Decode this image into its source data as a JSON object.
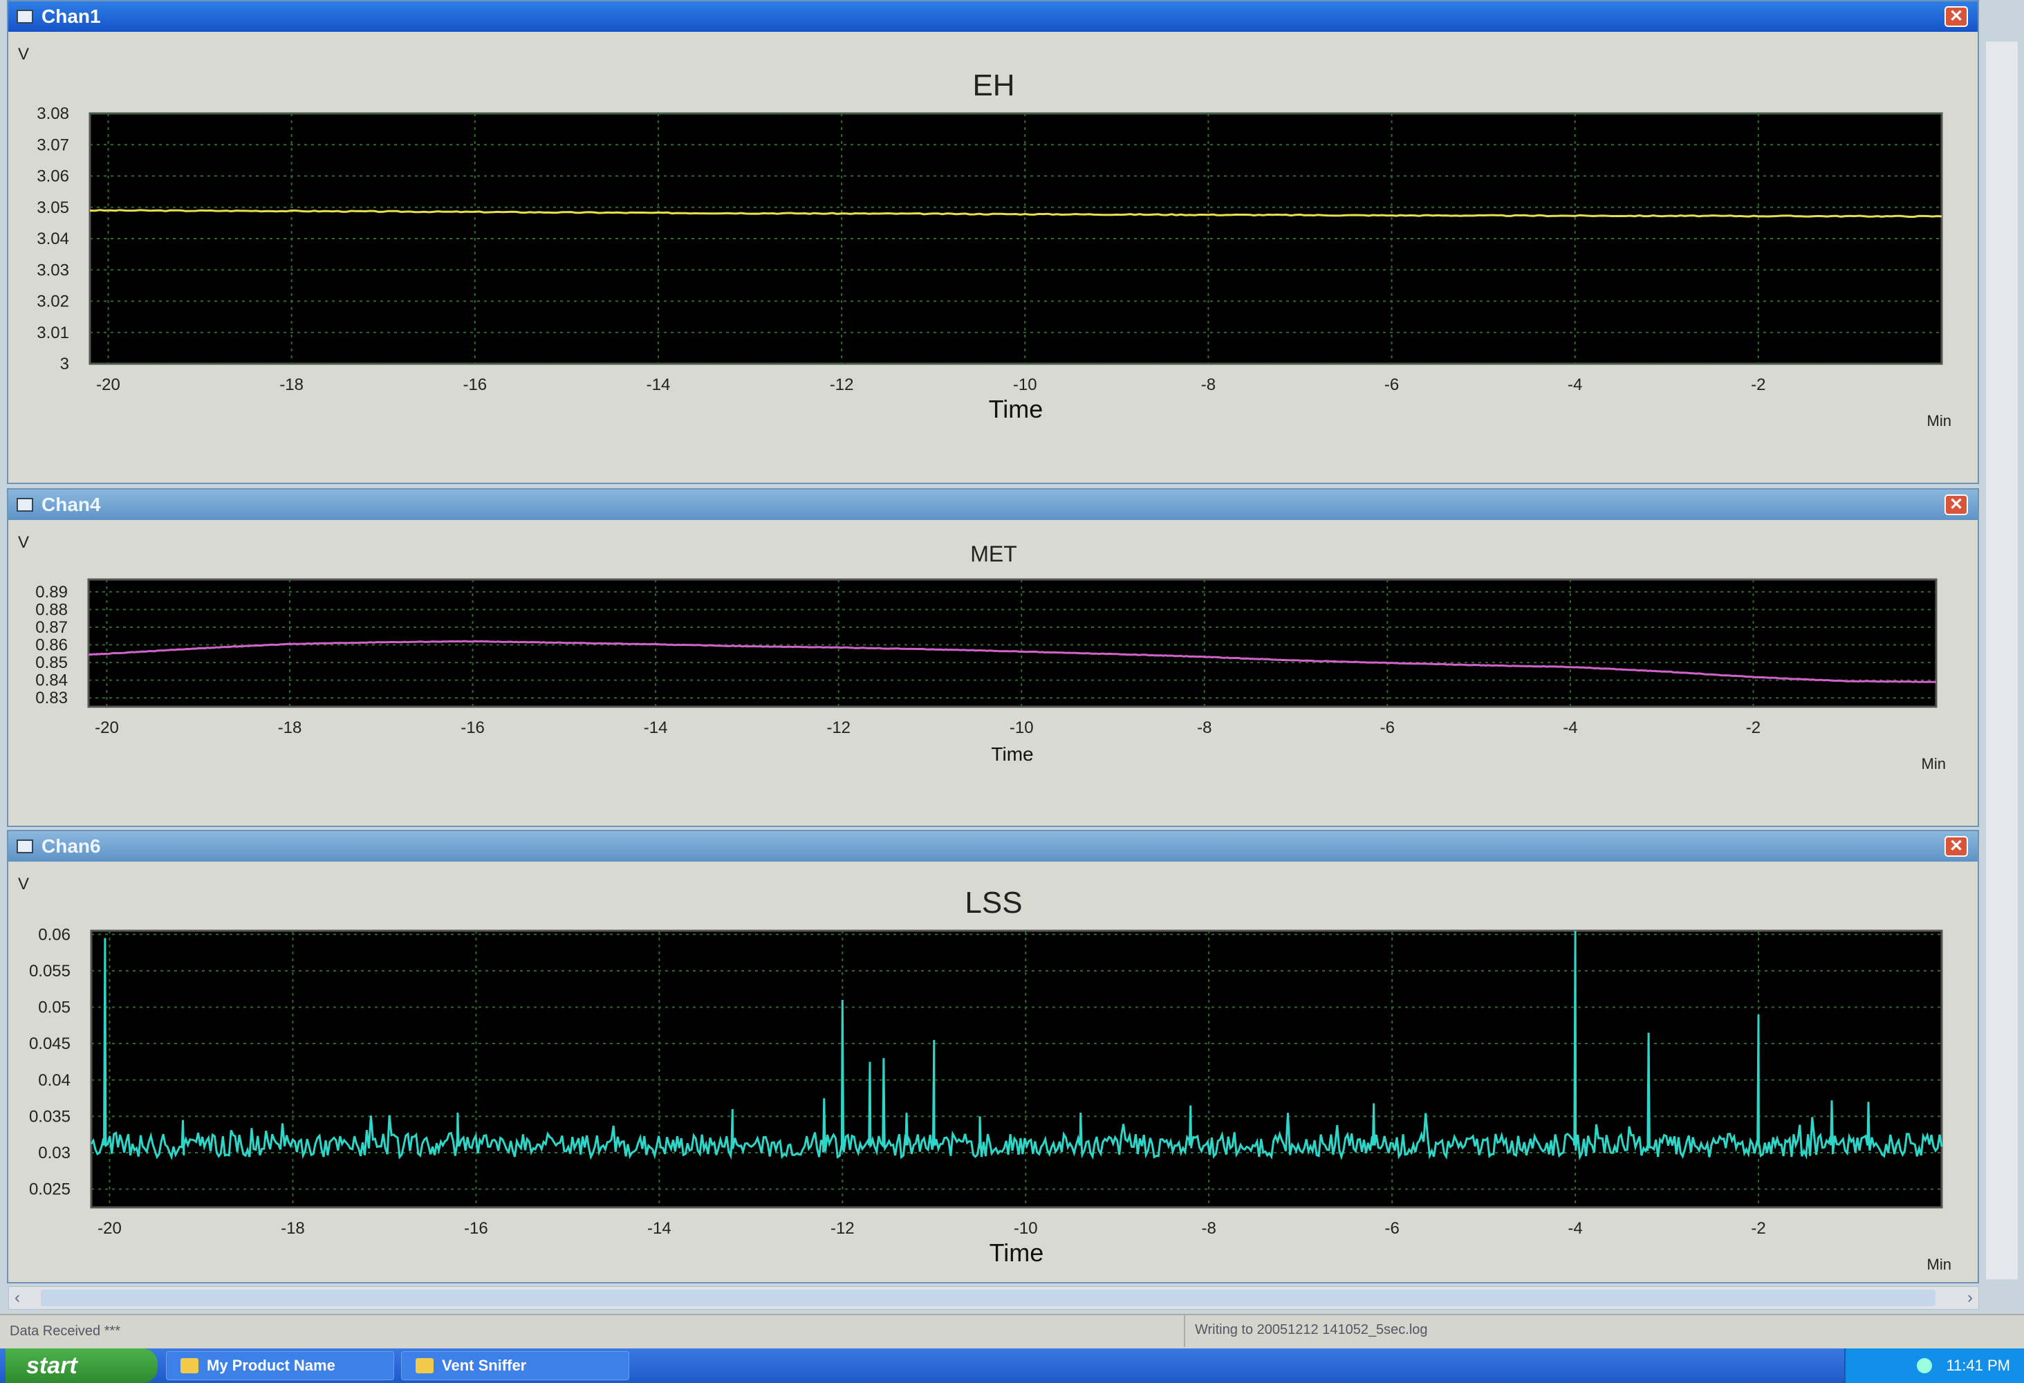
{
  "windows": [
    {
      "title": "Chan1",
      "active": true,
      "close": "✕",
      "chart": {
        "type": "line",
        "title": "EH",
        "ylabel": "V",
        "xlabel": "Time",
        "xunit": "Min",
        "ylim": [
          3.0,
          3.08
        ],
        "xlim": [
          -20.2,
          0.0
        ],
        "yticks": [
          "3",
          "3.01",
          "3.02",
          "3.03",
          "3.04",
          "3.05",
          "3.06",
          "3.07",
          "3.08"
        ],
        "ytick_values": [
          3.0,
          3.01,
          3.02,
          3.03,
          3.04,
          3.05,
          3.06,
          3.07,
          3.08
        ],
        "xticks": [
          "-20",
          "-18",
          "-16",
          "-14",
          "-12",
          "-10",
          "-8",
          "-6",
          "-4",
          "-2"
        ],
        "xtick_values": [
          -20,
          -18,
          -16,
          -14,
          -12,
          -10,
          -8,
          -6,
          -4,
          -2
        ],
        "color": "#e8e04a",
        "x": [
          -20.2,
          -18,
          -16,
          -14,
          -12,
          -10,
          -8,
          -6,
          -4,
          -2,
          0
        ],
        "y": [
          3.049,
          3.0488,
          3.0485,
          3.0482,
          3.048,
          3.0478,
          3.0476,
          3.0474,
          3.0473,
          3.0472,
          3.0471
        ]
      }
    },
    {
      "title": "Chan4",
      "active": false,
      "close": "✕",
      "chart": {
        "type": "line",
        "title": "MET",
        "ylabel": "V",
        "xlabel": "Time",
        "xunit": "Min",
        "ylim": [
          0.825,
          0.897
        ],
        "xlim": [
          -20.2,
          0.0
        ],
        "yticks": [
          "0.83",
          "0.84",
          "0.85",
          "0.86",
          "0.87",
          "0.88",
          "0.89"
        ],
        "ytick_values": [
          0.83,
          0.84,
          0.85,
          0.86,
          0.87,
          0.88,
          0.89
        ],
        "xticks": [
          "-20",
          "-18",
          "-16",
          "-14",
          "-12",
          "-10",
          "-8",
          "-6",
          "-4",
          "-2"
        ],
        "xtick_values": [
          -20,
          -18,
          -16,
          -14,
          -12,
          -10,
          -8,
          -6,
          -4,
          -2
        ],
        "color": "#d062c8",
        "x": [
          -20.2,
          -20,
          -19,
          -18,
          -17,
          -16,
          -15,
          -14,
          -13,
          -12,
          -11,
          -10,
          -9,
          -8,
          -7,
          -6,
          -5,
          -4,
          -3,
          -2,
          -1,
          0
        ],
        "y": [
          0.8545,
          0.855,
          0.858,
          0.8605,
          0.8615,
          0.862,
          0.8612,
          0.8603,
          0.8592,
          0.8585,
          0.8575,
          0.8562,
          0.8548,
          0.8532,
          0.8512,
          0.8498,
          0.8485,
          0.8475,
          0.845,
          0.8418,
          0.8395,
          0.839
        ]
      }
    },
    {
      "title": "Chan6",
      "active": false,
      "close": "✕",
      "chart": {
        "type": "line",
        "title": "LSS",
        "ylabel": "V",
        "xlabel": "Time",
        "xunit": "Min",
        "ylim": [
          0.0225,
          0.0605
        ],
        "xlim": [
          -20.2,
          0.0
        ],
        "yticks": [
          "0.025",
          "0.03",
          "0.035",
          "0.04",
          "0.045",
          "0.05",
          "0.055",
          "0.06"
        ],
        "ytick_values": [
          0.025,
          0.03,
          0.035,
          0.04,
          0.045,
          0.05,
          0.055,
          0.06
        ],
        "xticks": [
          "-20",
          "-18",
          "-16",
          "-14",
          "-12",
          "-10",
          "-8",
          "-6",
          "-4",
          "-2"
        ],
        "xtick_values": [
          -20,
          -18,
          -16,
          -14,
          -12,
          -10,
          -8,
          -6,
          -4,
          -2
        ],
        "color": "#2ed6c8",
        "baseline": 0.031,
        "spikes": [
          [
            -20.05,
            0.0595
          ],
          [
            -19.2,
            0.0345
          ],
          [
            -16.2,
            0.0355
          ],
          [
            -13.2,
            0.036
          ],
          [
            -12.2,
            0.0375
          ],
          [
            -12.0,
            0.051
          ],
          [
            -11.7,
            0.0425
          ],
          [
            -11.55,
            0.043
          ],
          [
            -11.3,
            0.0355
          ],
          [
            -11.0,
            0.0455
          ],
          [
            -10.5,
            0.035
          ],
          [
            -9.4,
            0.0355
          ],
          [
            -8.2,
            0.0365
          ],
          [
            -6.2,
            0.0368
          ],
          [
            -4.0,
            0.0605
          ],
          [
            -3.2,
            0.0465
          ],
          [
            -2.0,
            0.049
          ],
          [
            -1.2,
            0.0372
          ],
          [
            -0.8,
            0.037
          ]
        ]
      }
    }
  ],
  "status": {
    "left": "Data Received ***",
    "right": "Writing to 20051212 141052_5sec.log"
  },
  "taskbar": {
    "start_label": "start",
    "items": [
      "My Product Name",
      "Vent Sniffer"
    ],
    "clock": "11:41 PM"
  }
}
